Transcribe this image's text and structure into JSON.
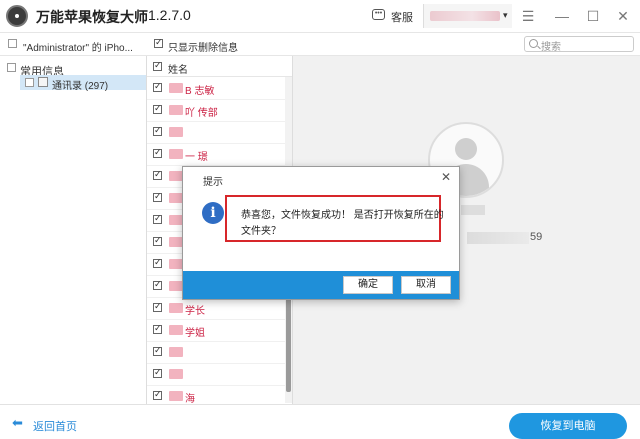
{
  "app": {
    "title": "万能苹果恢复大师",
    "version": "1.2.7.0",
    "support_label": "客服",
    "dropdown_glyph": "▾"
  },
  "window_controls": {
    "menu": "☰",
    "minimize": "—",
    "maximize": "☐",
    "close": "✕"
  },
  "toolbar": {
    "device_label": "\"Administrator\" 的 iPho...",
    "only_deleted_label": "只显示删除信息",
    "search_placeholder": "搜索"
  },
  "categories": {
    "heading": "常用信息",
    "items": [
      {
        "label": "通讯录 (297)"
      }
    ]
  },
  "list": {
    "header": "姓名",
    "rows": [
      {
        "text": "B 志敏"
      },
      {
        "text": "吖 传部"
      },
      {
        "text": ""
      },
      {
        "text": "一 璟"
      },
      {
        "text": "吖"
      },
      {
        "text": ""
      },
      {
        "text": ""
      },
      {
        "text": ""
      },
      {
        "text": ""
      },
      {
        "text": ""
      },
      {
        "text": "学长"
      },
      {
        "text": "学姐"
      },
      {
        "text": ""
      },
      {
        "text": ""
      },
      {
        "text": "海"
      }
    ]
  },
  "detail": {
    "phone_tail": "59"
  },
  "dialog": {
    "title": "提示",
    "close_glyph": "✕",
    "info_glyph": "i",
    "message_line1": "恭喜您，文件恢复成功！ 是否打开恢复所在的",
    "message_line2": "文件夹？",
    "confirm_label": "确定",
    "cancel_label": "取消"
  },
  "footer": {
    "back_label": "返回首页",
    "back_glyph": "⬅",
    "recover_label": "恢复到电脑"
  },
  "colors": {
    "accent": "#1f97e0",
    "highlight_frame": "#d7262a",
    "selected_row": "#d3e7f7"
  }
}
